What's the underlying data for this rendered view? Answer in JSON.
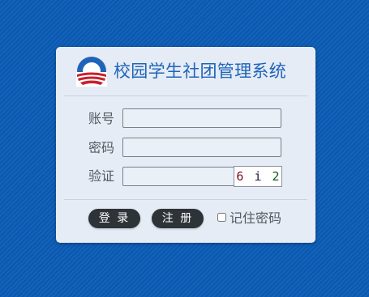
{
  "login": {
    "title": "校园学生社团管理系统",
    "fields": {
      "account_label": "账号",
      "account_value": "",
      "password_label": "密码",
      "password_value": "",
      "captcha_label": "验证",
      "captcha_value": ""
    },
    "captcha": {
      "chars": [
        "6",
        "i",
        "2"
      ],
      "colors": [
        "#7a1020",
        "#1a1a3a",
        "#0d5a1a"
      ]
    },
    "buttons": {
      "login_label": "登 录",
      "register_label": "注 册"
    },
    "remember": {
      "label": "记住密码",
      "checked": false
    },
    "logo_icon": "obama-style-rising-sun-logo"
  },
  "colors": {
    "background": "#0a5bb5",
    "card": "#e5ecf5",
    "title": "#1f64b9",
    "button": "#2e3338"
  }
}
